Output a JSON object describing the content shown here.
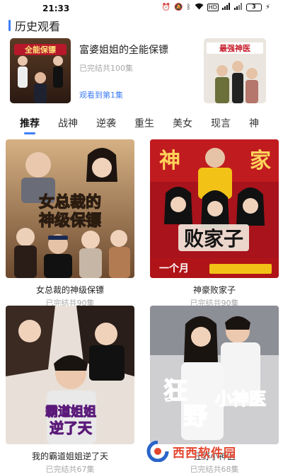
{
  "status_bar": {
    "time": "21:33",
    "network": "HD",
    "battery": "3"
  },
  "history": {
    "title": "历史观看",
    "items": [
      {
        "name": "富婆姐姐的全能保镖",
        "status": "已完结共100集",
        "progress": "观看到第1集",
        "poster_text": "全能保镖"
      },
      {
        "poster_text": "最强神医"
      }
    ]
  },
  "tabs": [
    "推荐",
    "战神",
    "逆袭",
    "重生",
    "美女",
    "现言",
    "神"
  ],
  "active_tab": 0,
  "cards": [
    {
      "title": "女总裁的神级保镖",
      "status": "已完结共90集",
      "poster_lines": [
        "女总裁的",
        "神级保镖"
      ]
    },
    {
      "title": "神豪败家子",
      "status": "已完结共90集",
      "poster_lines": [
        "神",
        "家",
        "败家子"
      ],
      "poster_sub": "一个月",
      "poster_sub2": "一个月"
    },
    {
      "title": "我的霸道姐姐逆了天",
      "status": "已完结共67集",
      "poster_lines": [
        "霸道姐姐",
        "逆了天"
      ]
    },
    {
      "title": "狂野小神医",
      "status": "已完结共68集",
      "poster_lines": [
        "狂",
        "野",
        "小神医"
      ]
    }
  ],
  "watermark": {
    "text": "西西软件园"
  },
  "colors": {
    "accent": "#3f7ef7",
    "muted": "#a8a8a8",
    "watermark": "#e3462f"
  }
}
